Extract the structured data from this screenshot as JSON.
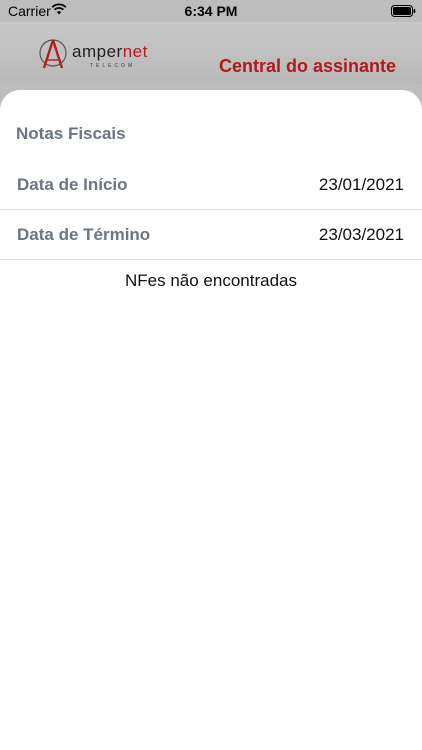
{
  "status_bar": {
    "carrier": "Carrier",
    "time": "6:34 PM",
    "wifi_icon": "wifi-icon",
    "battery_icon": "battery-icon"
  },
  "header": {
    "logo_name": "ampernet",
    "logo_sub": "TELECOM",
    "title": "Central do assinante",
    "brand_color": "#b01a1a"
  },
  "sheet": {
    "title": "Notas Fiscais",
    "rows": [
      {
        "label": "Data de Início",
        "value": "23/01/2021"
      },
      {
        "label": "Data de Término",
        "value": "23/03/2021"
      }
    ],
    "empty_message": "NFes não encontradas"
  }
}
